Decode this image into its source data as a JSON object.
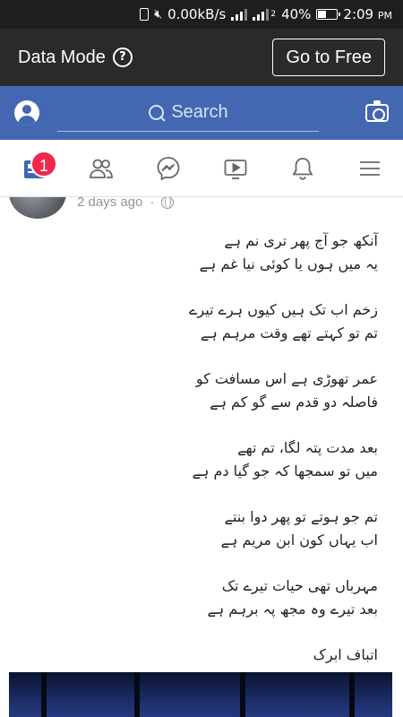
{
  "status_bar": {
    "network_speed": "0.00kB/s",
    "sim_label": "2",
    "battery": "40%",
    "battery_level": 0.4,
    "time": "2:09",
    "ampm": "PM"
  },
  "data_mode": {
    "title": "Data Mode",
    "help_icon": "?",
    "go_free_label": "Go to Free"
  },
  "search": {
    "placeholder": "Search"
  },
  "nav": {
    "badge_count": "1",
    "tabs": [
      "news-feed",
      "friends",
      "messenger",
      "watch",
      "notifications",
      "menu"
    ]
  },
  "post": {
    "timestamp": "2 days ago",
    "separator": "·",
    "stanzas": [
      [
        "آنکھ جو آج پھر تری نم ہے",
        "یہ میں ہوں یا کوئی نیا غم ہے"
      ],
      [
        "زخم اب تک ہیں کیوں ہرے تیرے",
        "تم تو کہتے تھے وقت مرہم ہے"
      ],
      [
        "عمر تھوڑی ہے اس مسافت کو",
        "فاصلہ دو قدم سے گو کم ہے"
      ],
      [
        "بعد مدت پتہ لگا، تم تھے",
        "میں تو سمجھا کہ جو گیا دم ہے"
      ],
      [
        "تم جو ہوتے تو پھر دوا بنتے",
        "اب یہاں کون ابن مریم ہے"
      ],
      [
        "مہرباں تھی حیات تیرے تک",
        "بعد تیرے وہ مجھ پہ برہم ہے"
      ]
    ],
    "poet": "اتباف ابرک"
  },
  "colors": {
    "fb_blue": "#4367b0",
    "badge_red": "#f02849",
    "dark_bar": "#2a2a2a"
  }
}
